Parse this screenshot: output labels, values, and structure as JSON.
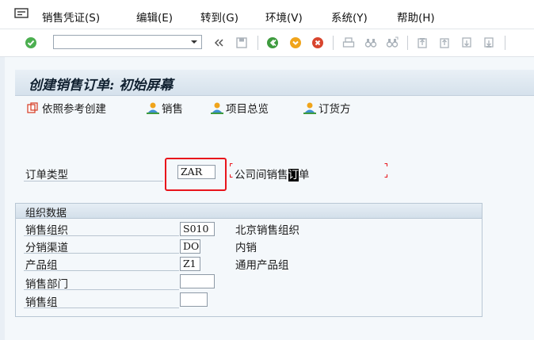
{
  "menubar": {
    "items": [
      {
        "label": "销售凭证(S)"
      },
      {
        "label": "编辑(E)"
      },
      {
        "label": "转到(G)"
      },
      {
        "label": "环境(V)"
      },
      {
        "label": "系统(Y)"
      },
      {
        "label": "帮助(H)"
      }
    ]
  },
  "toolbar": {
    "command_value": "",
    "icons": [
      "enter-icon",
      "command-field",
      "back-arrows-icon",
      "save-icon",
      "back-icon",
      "exit-icon",
      "cancel-icon",
      "print-icon",
      "find-icon",
      "find-next-icon",
      "first-page-icon",
      "prev-page-icon",
      "next-page-icon",
      "last-page-icon"
    ]
  },
  "page": {
    "title": "创建销售订单: 初始屏幕"
  },
  "app_toolbar": {
    "create_ref_label": "依照参考创建",
    "sales_label": "销售",
    "item_overview_label": "项目总览",
    "sold_to_label": "订货方"
  },
  "order_type": {
    "label": "订单类型",
    "value": "ZAR",
    "description_prefix": "公司间销售",
    "description_highlight": "订",
    "description_suffix": "单"
  },
  "org_data": {
    "title": "组织数据",
    "rows": [
      {
        "label": "销售组织",
        "value": "S010",
        "description": "北京销售组织"
      },
      {
        "label": "分销渠道",
        "value": "DO",
        "description": "内销"
      },
      {
        "label": "产品组",
        "value": "Z1",
        "description": "通用产品组"
      },
      {
        "label": "销售部门",
        "value": "",
        "description": ""
      },
      {
        "label": "销售组",
        "value": "",
        "description": ""
      }
    ]
  },
  "colors": {
    "highlight_box": "#e8141b",
    "background": "#f4f8fb"
  }
}
